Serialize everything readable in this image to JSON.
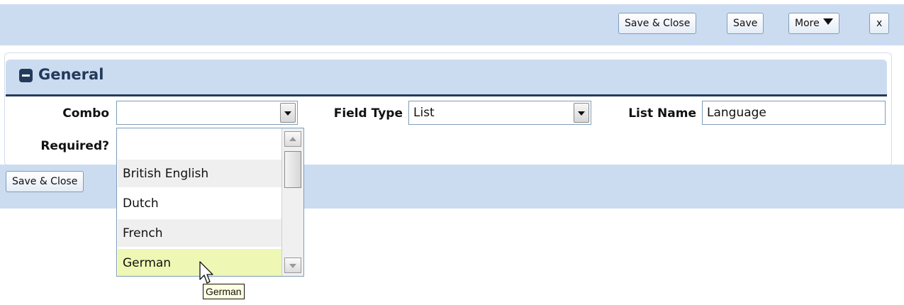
{
  "toolbar": {
    "save_close": "Save & Close",
    "save": "Save",
    "more": "More",
    "close": "x"
  },
  "panel": {
    "title": "General",
    "fields": {
      "combo_label": "Combo",
      "combo_value": "",
      "field_type_label": "Field Type",
      "field_type_value": "List",
      "list_name_label": "List Name",
      "list_name_value": "Language",
      "required_label": "Required?"
    }
  },
  "bottom": {
    "save_close": "Save & Close"
  },
  "dropdown": {
    "options": [
      "",
      "British English",
      "Dutch",
      "French",
      "German"
    ],
    "highlighted": "German"
  },
  "tooltip": "German",
  "colors": {
    "toolbar_bg": "#ccdcf0",
    "header_accent": "#233a5c",
    "highlight": "#eef7b3",
    "tooltip_bg": "#ffffe1"
  }
}
